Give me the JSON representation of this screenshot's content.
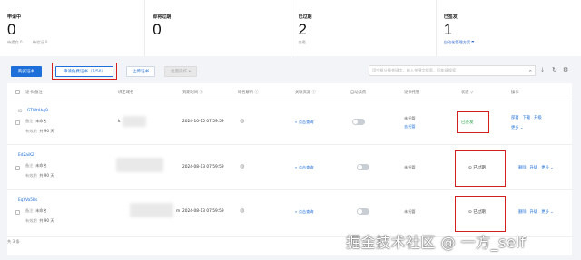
{
  "stats": [
    {
      "label": "申请中",
      "value": "0",
      "sub": [
        "待提交 0",
        "待验证 0"
      ],
      "link": ""
    },
    {
      "label": "即将过期",
      "value": "0",
      "sub": [],
      "link": ""
    },
    {
      "label": "已过期",
      "value": "2",
      "sub": [
        "查看"
      ],
      "link": ""
    },
    {
      "label": "已签发",
      "value": "1",
      "sub": [],
      "link": "自动化管理方案 ⧉"
    }
  ],
  "toolbar": {
    "buy": "购买证书",
    "apply_free": "申请免费证书（1/50）",
    "upload": "上传证书",
    "batch": "批量操作 ▾",
    "search_placeholder": "用空格分隔关键字，输入关键字搜索，回车键搜索"
  },
  "table": {
    "headers": [
      "证书/备注",
      "绑定域名",
      "到期时间 ⓘ",
      "域名解析 ⓘ",
      "关联资源 ⓘ",
      "自动续费",
      "证书托管",
      "状态 ▽",
      "操作"
    ],
    "rows": [
      {
        "id": "GTWtAhg9",
        "remark_label": "备注",
        "remark": "未命名",
        "validity_label": "有效期",
        "validity": "共 90 天",
        "domain": "k",
        "expires": "2024-10-15 07:59:59",
        "query": "点击查询",
        "hosted": "未托管",
        "hosted2": "去托管",
        "status": "已签发",
        "status_color": "#2ba24c",
        "actions": [
          "部署",
          "下载",
          "升级"
        ],
        "more": "更多 ⌄"
      },
      {
        "id": "EdZaiKZ",
        "remark_label": "备注",
        "remark": "未命名",
        "validity_label": "有效期",
        "validity": "共 90 天",
        "domain": "",
        "expires": "2024-08-13 07:59:59",
        "query": "点击查询",
        "hosted": "未托管",
        "hosted2": "",
        "status": "已过期",
        "status_color": "#333333",
        "actions": [
          "删除",
          "升级"
        ],
        "more": "更多 ⌄"
      },
      {
        "id": "EqYVa5Bs",
        "remark_label": "备注",
        "remark": "未命名",
        "validity_label": "有效期",
        "validity": "共 90 天",
        "domain": "m",
        "expires": "2024-08-13 07:59:59",
        "query": "点击查询",
        "hosted": "未托管",
        "hosted2": "",
        "status": "已过期",
        "status_color": "#333333",
        "actions": [
          "删除",
          "升级"
        ],
        "more": "更多 ⌄"
      }
    ]
  },
  "footer": {
    "total": "共 3 条"
  },
  "watermark": "掘金技术社区 @ 一方_self",
  "colors": {
    "accent": "#1e6fd9",
    "highlight": "#d2201e",
    "success": "#2ba24c"
  }
}
